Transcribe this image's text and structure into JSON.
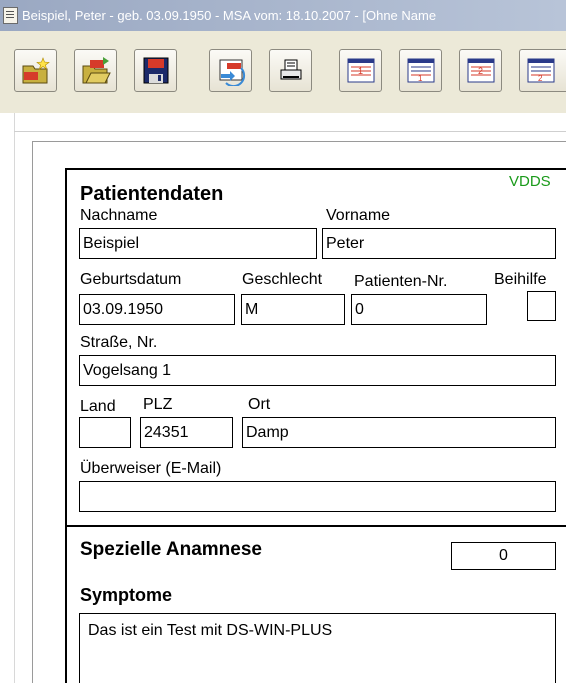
{
  "window": {
    "title": "Beispiel, Peter - geb. 03.09.1950 - MSA vom: 18.10.2007 - [Ohne Name"
  },
  "toolbar": {
    "buttons": [
      {
        "name": "new-msa-button",
        "icon": "new-msa-icon",
        "badge": "MSA"
      },
      {
        "name": "open-msa-button",
        "icon": "open-msa-icon",
        "badge": "MSA"
      },
      {
        "name": "save-msa-button",
        "icon": "save-msa-icon",
        "badge": "MSA"
      },
      {
        "name": "transfer-msa-button",
        "icon": "transfer-msa-icon",
        "badge": "MSA"
      },
      {
        "name": "print-button",
        "icon": "printer-icon"
      },
      {
        "name": "form-1-button",
        "icon": "form-1-icon",
        "badge": "1"
      },
      {
        "name": "form-1b-button",
        "icon": "form-1b-icon",
        "badge": "1"
      },
      {
        "name": "form-2-button",
        "icon": "form-2-icon",
        "badge": "2"
      },
      {
        "name": "form-2b-button",
        "icon": "form-2b-icon",
        "badge": "2"
      }
    ]
  },
  "form": {
    "vdds": "VDDS",
    "section_title": "Patientendaten",
    "nachname_label": "Nachname",
    "nachname_value": "Beispiel",
    "vorname_label": "Vorname",
    "vorname_value": "Peter",
    "geburtsdatum_label": "Geburtsdatum",
    "geburtsdatum_value": "03.09.1950",
    "geschlecht_label": "Geschlecht",
    "geschlecht_value": "M",
    "patientennr_label": "Patienten-Nr.",
    "patientennr_value": "0",
    "beihilfe_label": "Beihilfe",
    "beihilfe_value": "",
    "strasse_label": "Straße, Nr.",
    "strasse_value": "Vogelsang 1",
    "land_label": "Land",
    "land_value": "",
    "plz_label": "PLZ",
    "plz_value": "24351",
    "ort_label": "Ort",
    "ort_value": "Damp",
    "ueberweiser_label": "Überweiser (E-Mail)",
    "ueberweiser_value": "",
    "anamnese_title": "Spezielle Anamnese",
    "anamnese_count": "0",
    "symptome_title": "Symptome",
    "symptome_value": "Das ist ein Test mit DS-WIN-PLUS"
  },
  "colors": {
    "titlebar": "#9aa8c2",
    "vdds": "#1a9a1a",
    "toolbar_bg": "#ece9d8"
  }
}
